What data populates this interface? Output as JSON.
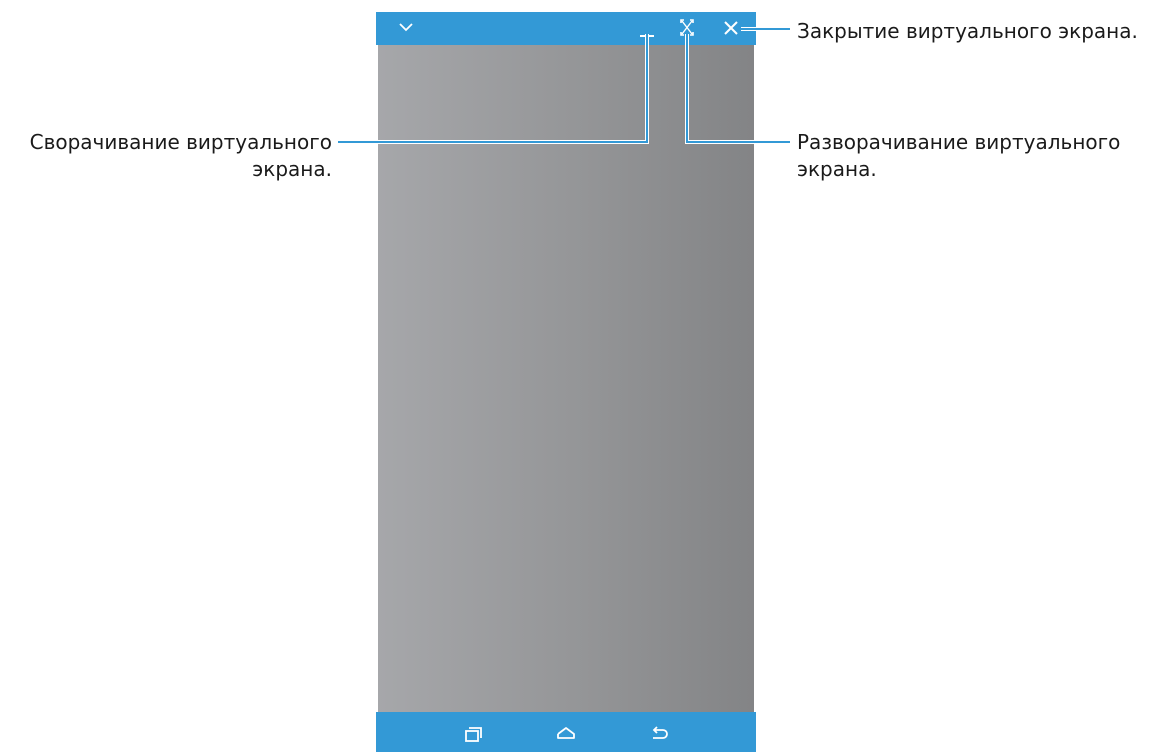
{
  "callouts": {
    "close": "Закрытие виртуального экрана.",
    "minimize_line1": "Сворачивание виртуального",
    "minimize_line2": "экрана.",
    "maximize_line1": "Разворачивание виртуального",
    "maximize_line2": "экрана."
  },
  "window": {
    "titlebar_color": "#3399d6",
    "titlebar_icons": [
      "chevron-down-icon",
      "minimize-icon",
      "maximize-icon",
      "close-icon"
    ],
    "navbar_icons": [
      "recent-apps-icon",
      "home-icon",
      "back-icon"
    ]
  },
  "colors": {
    "accent": "#3399d6",
    "screen_gray_light": "#a6a7aa",
    "screen_gray_dark": "#838486",
    "callout_line": "#3399d6"
  }
}
